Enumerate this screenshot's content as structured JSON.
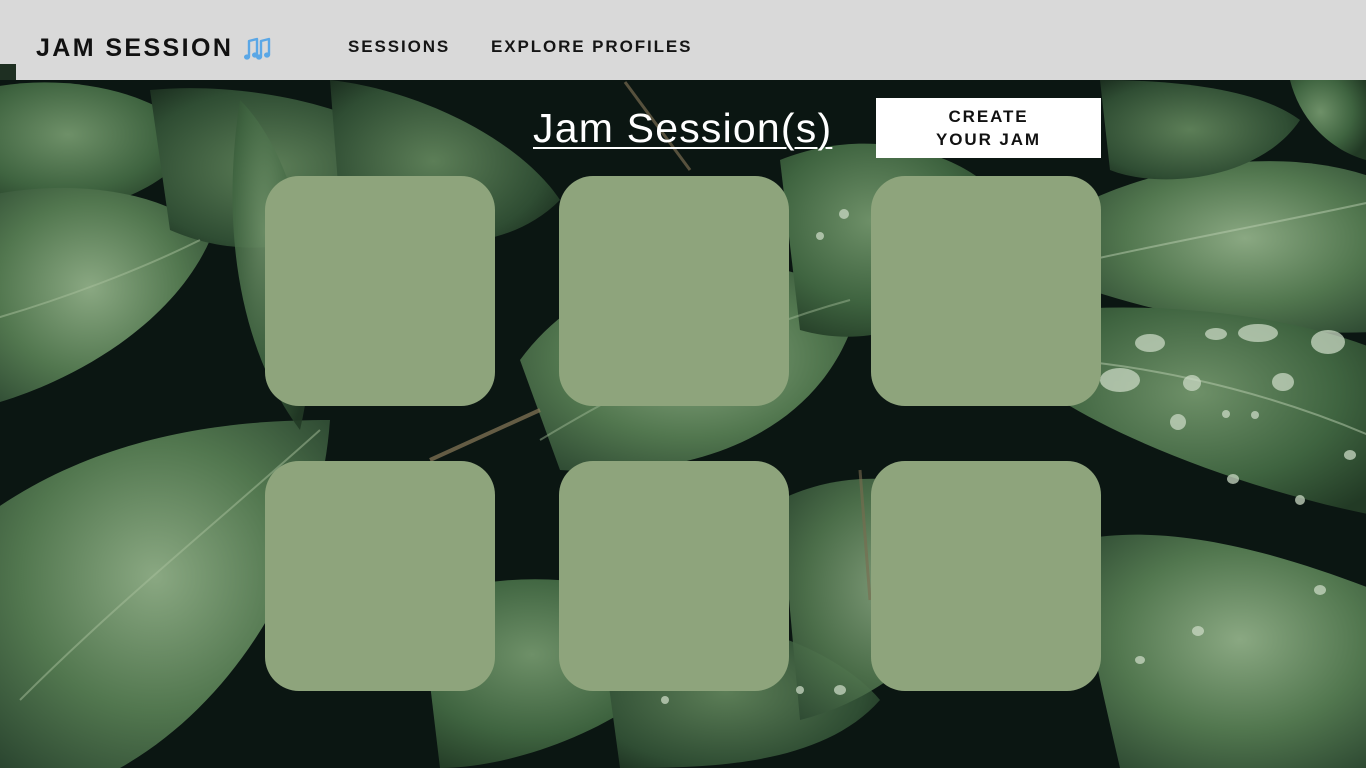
{
  "app": {
    "title": "JAM SESSION",
    "logo_icon": "music-notes-icon",
    "accent_color": "#5aa7e6"
  },
  "nav": {
    "items": [
      {
        "label": "SESSIONS"
      },
      {
        "label": "EXPLORE PROFILES"
      }
    ]
  },
  "main": {
    "heading": "Jam Session(s)",
    "create_button_label": "CREATE YOUR JAM",
    "card_color": "#8ea47c",
    "header_color": "#d9d9d9"
  }
}
